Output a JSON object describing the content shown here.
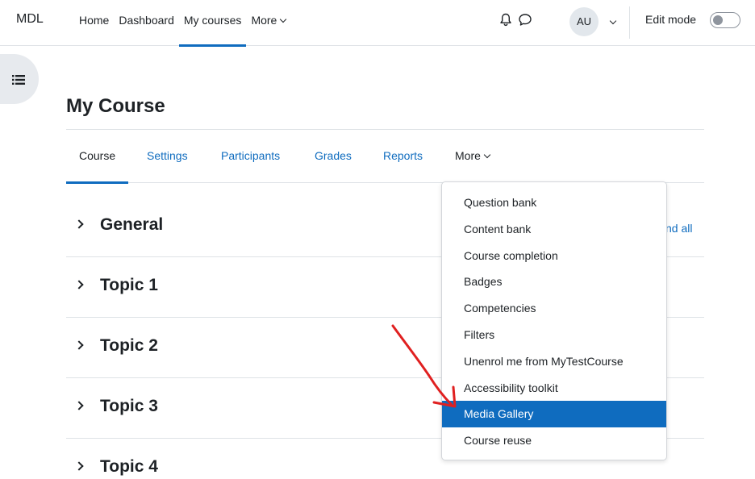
{
  "navbar": {
    "brand": "MDL",
    "items": [
      {
        "label": "Home"
      },
      {
        "label": "Dashboard"
      },
      {
        "label": "My courses"
      },
      {
        "label": "More"
      }
    ],
    "user_initials": "AU",
    "edit_mode_label": "Edit mode",
    "edit_mode_on": false
  },
  "page": {
    "title": "My Course"
  },
  "secondary_nav": {
    "items": [
      {
        "label": "Course"
      },
      {
        "label": "Settings"
      },
      {
        "label": "Participants"
      },
      {
        "label": "Grades"
      },
      {
        "label": "Reports"
      },
      {
        "label": "More"
      }
    ]
  },
  "sections": [
    {
      "title": "General"
    },
    {
      "title": "Topic 1"
    },
    {
      "title": "Topic 2"
    },
    {
      "title": "Topic 3"
    },
    {
      "title": "Topic 4"
    }
  ],
  "expand_all_partial": "nd all",
  "more_menu": {
    "items": [
      {
        "label": "Question bank"
      },
      {
        "label": "Content bank"
      },
      {
        "label": "Course completion"
      },
      {
        "label": "Badges"
      },
      {
        "label": "Competencies"
      },
      {
        "label": "Filters"
      },
      {
        "label": "Unenrol me from MyTestCourse"
      },
      {
        "label": "Accessibility toolkit"
      },
      {
        "label": "Media Gallery"
      },
      {
        "label": "Course reuse"
      }
    ],
    "highlighted": "Media Gallery"
  },
  "colors": {
    "accent": "#0f6cbf",
    "text": "#1d2125",
    "annotation": "#e02020"
  },
  "icons": [
    "list-icon",
    "bell-icon",
    "chat-icon",
    "chevron-down-icon",
    "caret-right-icon"
  ]
}
